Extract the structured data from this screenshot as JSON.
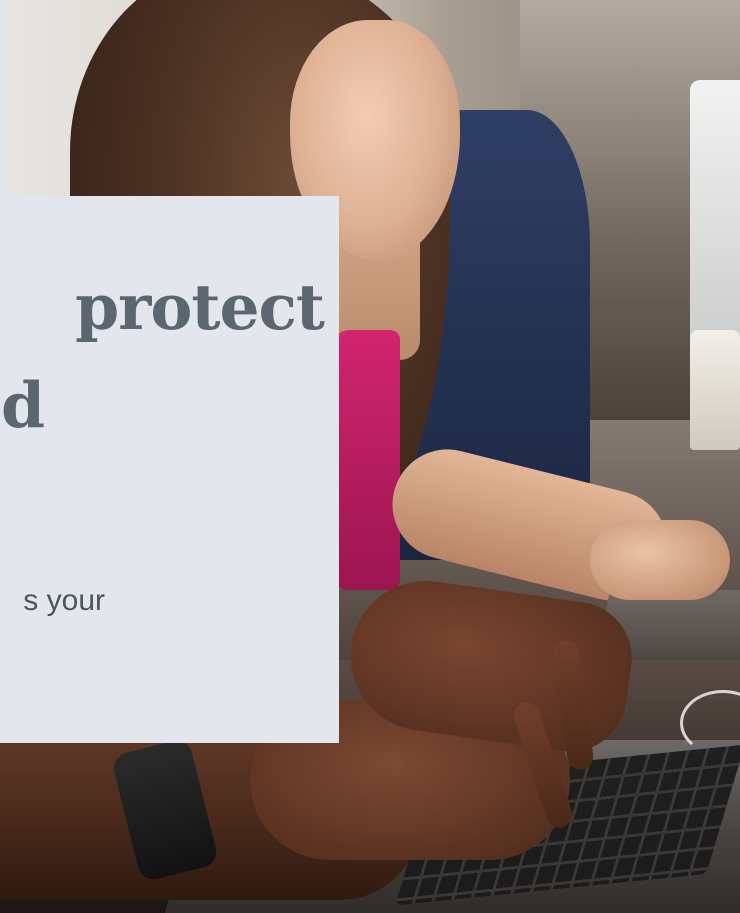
{
  "hero": {
    "image_icon": "photo-people-typing-on-laptops-icon"
  },
  "card": {
    "headline": "protect\nd",
    "headline_line1": "protect",
    "headline_line2": "d",
    "body": "s your"
  },
  "colors": {
    "card_background": "#e3e7ed",
    "headline": "#5b6670",
    "body_text": "#4a5560"
  }
}
